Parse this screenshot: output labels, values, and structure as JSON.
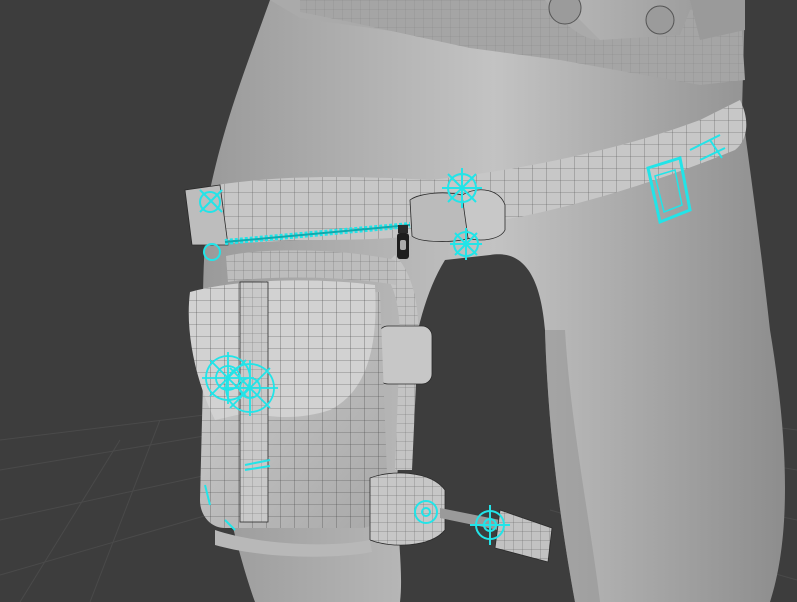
{
  "viewport": {
    "kind": "3d-viewport",
    "shading": "solid-wireframe-overlay",
    "subject": "thigh-holster-belt-bag",
    "colors": {
      "background": "#3d3d3d",
      "floor_grid": "#4a4a4a",
      "body": "#b9b9b9",
      "body_shadow": "#8f8f8f",
      "mesh_wire": "#2a2a2a",
      "selection": "#22e4e8",
      "zipper_pull": "#1e1e1e"
    },
    "icons": [
      "gear-icon",
      "zipper-pull-icon",
      "buckle-icon"
    ]
  }
}
